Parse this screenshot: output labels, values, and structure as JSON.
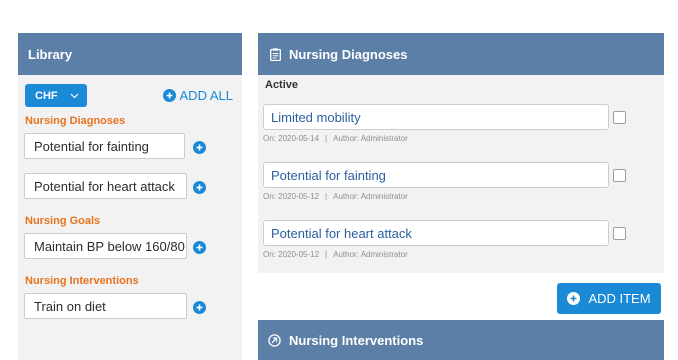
{
  "library": {
    "title": "Library",
    "select_value": "CHF",
    "add_all_label": "ADD ALL",
    "sections": [
      {
        "title": "Nursing Diagnoses",
        "items": [
          "Potential for fainting",
          "Potential for heart attack"
        ]
      },
      {
        "title": "Nursing Goals",
        "items": [
          "Maintain BP below 160/80"
        ]
      },
      {
        "title": "Nursing Interventions",
        "items": [
          "Train on diet"
        ]
      }
    ]
  },
  "diagnoses": {
    "title": "Nursing Diagnoses",
    "status_label": "Active",
    "entries": [
      {
        "name": "Limited mobility",
        "date": "On: 2020-05-14",
        "author": "Author: Administrator"
      },
      {
        "name": "Potential for fainting",
        "date": "On: 2020-05-12",
        "author": "Author: Administrator"
      },
      {
        "name": "Potential for heart attack",
        "date": "On: 2020-05-12",
        "author": "Author: Administrator"
      }
    ],
    "add_item_label": "ADD ITEM"
  },
  "interventions": {
    "title": "Nursing Interventions"
  },
  "colors": {
    "header": "#5b7fa6",
    "accent": "#1a8ad6",
    "section_title": "#e8731f"
  },
  "icons": {
    "library_add": "plus-circle-icon",
    "diagnoses_header": "clipboard-icon",
    "interventions_header": "arrow-circle-icon"
  }
}
